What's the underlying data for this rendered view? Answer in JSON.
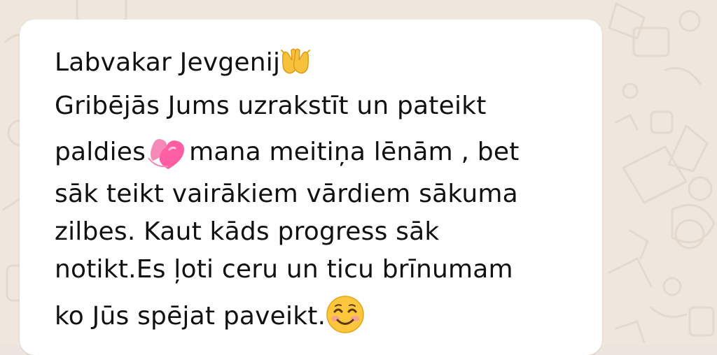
{
  "message": {
    "line1": "Labvakar Jevgenij",
    "line2": "Gribējās Jums uzrakstīt un pateikt",
    "line3_a": "paldies",
    "line3_b": "mana meitiņa lēnām , bet",
    "line4": "sāk teikt vairākiem vārdiem sākuma",
    "line5": "zilbes. Kaut kāds progress sāk",
    "line6": "notikt.Es ļoti ceru un ticu brīnumam",
    "line7": "ko Jūs spējat paveikt."
  },
  "emojis": {
    "after_line1": "raising-hands-icon",
    "after_paldies": "two-hearts-icon",
    "after_line7": "smiling-face-icon"
  },
  "colors": {
    "wallpaper": "#efe7dd",
    "bubble": "#ffffff",
    "text": "#111111"
  }
}
